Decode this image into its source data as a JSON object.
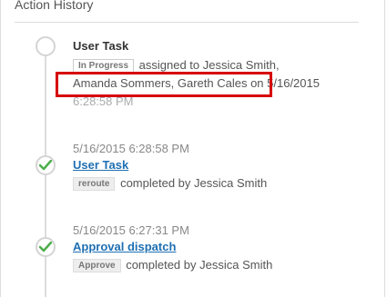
{
  "section": {
    "title": "Action History"
  },
  "entries": [
    {
      "title": "User Task",
      "status_badge": "In Progress",
      "line1_text": "assigned to Jessica Smith,",
      "line2_text": "Amanda Sommers, Gareth Cales on 5/16/2015",
      "line3_text": "6:28:58 PM"
    },
    {
      "timestamp": "5/16/2015 6:28:58 PM",
      "title": "User Task",
      "badge": "reroute",
      "text": "completed by Jessica Smith"
    },
    {
      "timestamp": "5/16/2015 6:27:31 PM",
      "title": "Approval dispatch",
      "badge": "Approve",
      "text": "completed by Jessica Smith"
    }
  ],
  "colors": {
    "link": "#1f6fb2",
    "check": "#4cae4c",
    "highlight": "#d60000"
  },
  "icons": {
    "pending": "empty-circle-icon",
    "done": "check-circle-icon"
  }
}
